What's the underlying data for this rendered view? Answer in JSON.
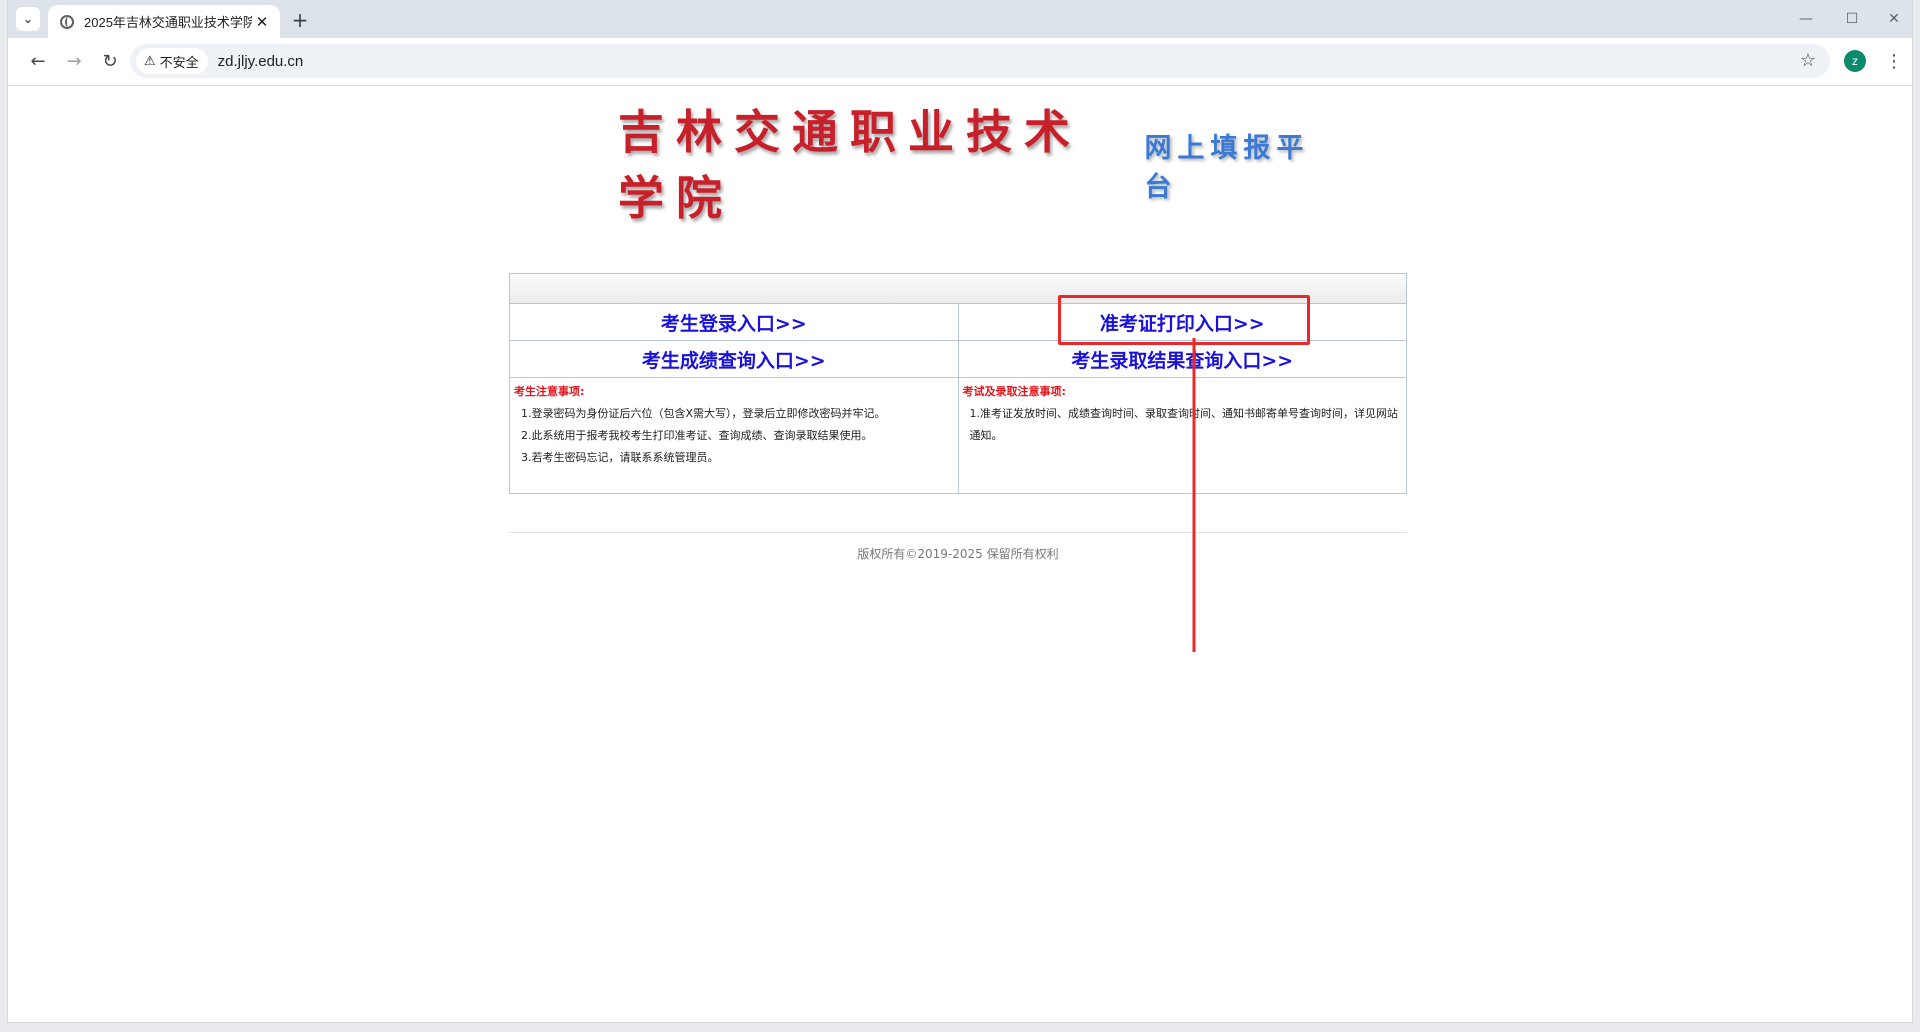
{
  "browser": {
    "tab_title": "2025年吉林交通职业技术学院",
    "security_label": "不安全",
    "url": "zd.jljy.edu.cn",
    "profile_initial": "z"
  },
  "page": {
    "logo_main": "吉林交通职业技术学院",
    "logo_sub": "网上填报平台",
    "links": {
      "student_login": "考生登录入口>>",
      "admission_ticket": "准考证打印入口>>",
      "score_query": "考生成绩查询入口>>",
      "admission_result": "考生录取结果查询入口>>"
    },
    "student_notes": {
      "title": "考生注意事项:",
      "items": [
        "1.登录密码为身份证后六位（包含X需大写），登录后立即修改密码并牢记。",
        "2.此系统用于报考我校考生打印准考证、查询成绩、查询录取结果使用。",
        "3.若考生密码忘记，请联系系统管理员。"
      ]
    },
    "exam_notes": {
      "title": "考试及录取注意事项:",
      "items": [
        "1.准考证发放时间、成绩查询时间、录取查询时间、通知书邮寄单号查询时间，详见网站通知。"
      ]
    },
    "copyright": "版权所有©2019-2025 保留所有权利"
  },
  "colors": {
    "link": "#1a12d8",
    "notes_title": "#e3141b",
    "logo_main": "#c8202a",
    "logo_sub": "#3a7ad6",
    "annotation": "#ea2a2a"
  }
}
